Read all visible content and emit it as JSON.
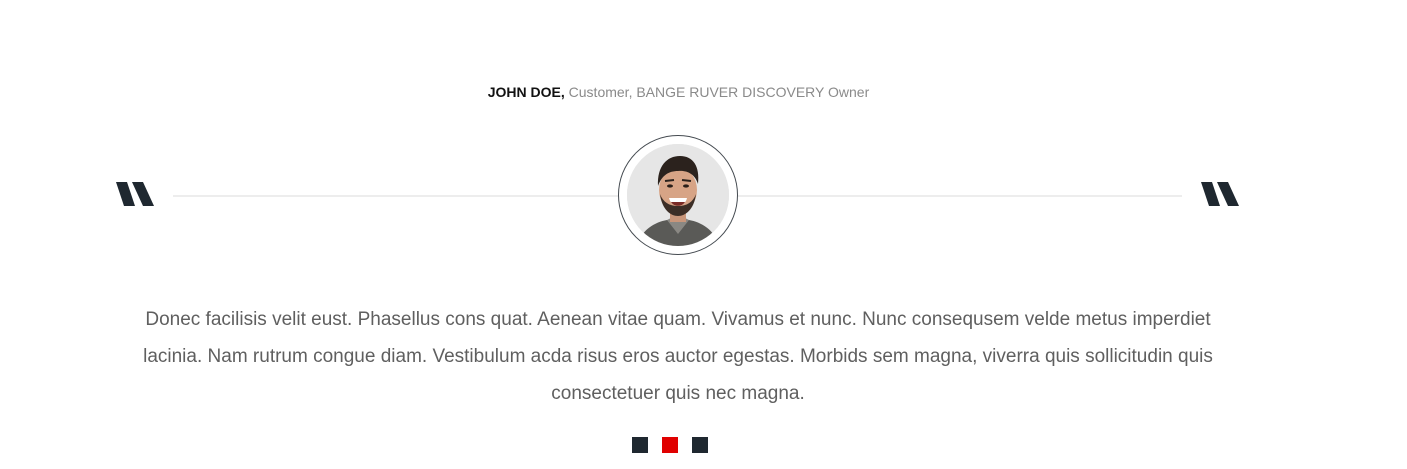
{
  "testimonial": {
    "author_name": "JOHN DOE,",
    "author_role": " Customer, BANGE RUVER DISCOVERY Owner",
    "quote": "Donec facilisis velit eust. Phasellus cons quat. Aenean vitae quam. Vivamus et nunc. Nunc consequsem velde metus imperdiet lacinia. Nam rutrum congue diam. Vestibulum acda risus eros auctor egestas. Morbids sem magna, viverra quis sollicitudin quis consectetuer quis nec magna."
  },
  "icons": {
    "quote_left": "quote-mark-icon",
    "quote_right": "quote-mark-icon",
    "avatar": "customer-avatar"
  },
  "pager": {
    "slides": 3,
    "active_index": 1
  },
  "colors": {
    "accent": "#e00000",
    "dark": "#1f2830",
    "text": "#5f5f5f",
    "muted": "#8a8a8a"
  }
}
